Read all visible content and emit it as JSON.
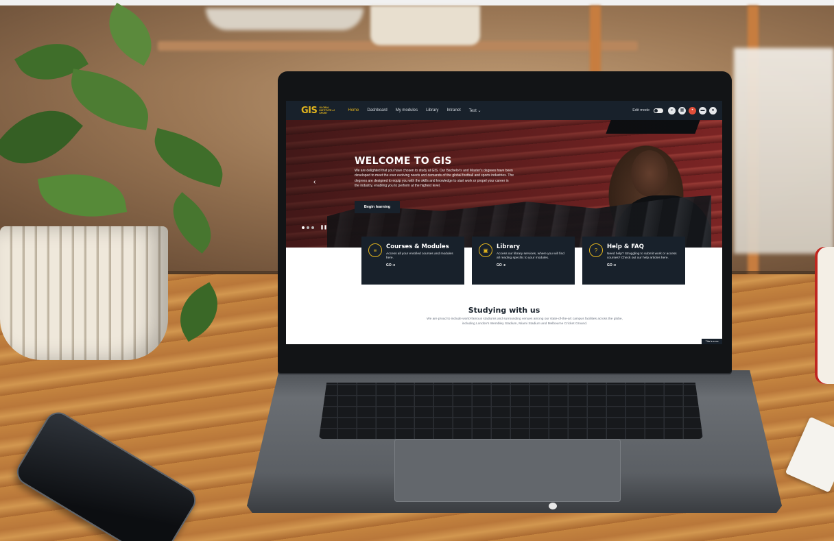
{
  "navbar": {
    "logo_mark": "GIS",
    "logo_text": "GLOBAL INSTITUTE of SPORT",
    "links": [
      "Home",
      "Dashboard",
      "My modules",
      "Library",
      "Intranet",
      "Test ⌄"
    ],
    "edit_mode_label": "Edit mode",
    "icons": [
      "search-icon",
      "grid-icon",
      "notification-icon",
      "chat-icon",
      "user-avatar-icon"
    ]
  },
  "hero": {
    "title": "WELCOME TO GIS",
    "text": "We are delighted that you have chosen to study at GIS. Our Bachelor's and Master's degrees have been developed to meet the ever evolving needs and demands of the global football and sports industries. The degrees are designed to equip you with the skills and knowledge to start work or propel your career in the industry, enabling you to perform at the highest level.",
    "button_label": "Begin learning",
    "prev_glyph": "‹",
    "pause_glyph": "❚❚"
  },
  "cards": [
    {
      "icon": "modules-icon",
      "icon_glyph": "≡",
      "title": "Courses & Modules",
      "text": "Access all your enrolled courses and modules here.",
      "go": "GO ➜"
    },
    {
      "icon": "library-icon",
      "icon_glyph": "▣",
      "title": "Library",
      "text": "Access our library services, where you will find all reading specific to your modules.",
      "go": "GO ➜"
    },
    {
      "icon": "help-icon",
      "icon_glyph": "?",
      "title": "Help & FAQ",
      "text": "Need help? Struggling to submit work or access courses? Check out our help articles here.",
      "go": "GO ➜"
    }
  ],
  "studying": {
    "title": "Studying with us",
    "text": "We are proud to include world-famous stadiums and surrounding venues among our state-of-the-art campus facilities across the globe, including London's Wembley Stadium, Miami Stadium and Melbourne Cricket Ground."
  },
  "footer_tag": "This is a mo",
  "colors": {
    "navy": "#18212b",
    "gold": "#e3b51d",
    "white": "#ffffff"
  }
}
